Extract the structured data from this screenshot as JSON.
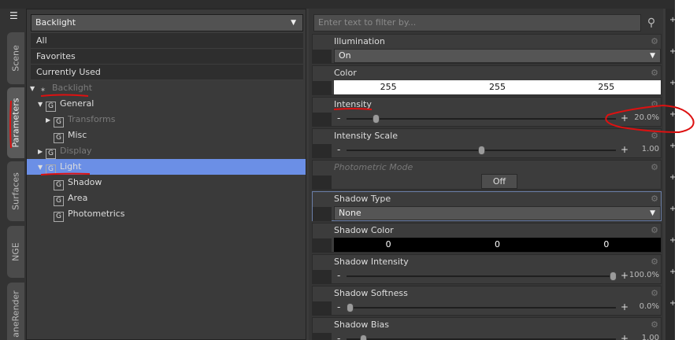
{
  "vertical_tabs": [
    "Scene",
    "Parameters",
    "Surfaces",
    "NGE",
    "aneRender"
  ],
  "active_tab": "Parameters",
  "left_panel": {
    "node_dropdown": "Backlight",
    "filters": [
      "All",
      "Favorites",
      "Currently Used"
    ],
    "tree": [
      {
        "label": "Backlight",
        "level": 0,
        "expanded": true,
        "dim": true,
        "icon": "light-icon"
      },
      {
        "label": "General",
        "level": 1,
        "expanded": true,
        "dim": false,
        "icon": "group-icon"
      },
      {
        "label": "Transforms",
        "level": 2,
        "expanded": false,
        "dim": true,
        "icon": "group-icon"
      },
      {
        "label": "Misc",
        "level": 2,
        "leaf": true,
        "dim": false,
        "icon": "group-icon"
      },
      {
        "label": "Display",
        "level": 1,
        "expanded": false,
        "dim": true,
        "icon": "group-icon"
      },
      {
        "label": "Light",
        "level": 1,
        "expanded": true,
        "dim": false,
        "selected": true,
        "icon": "group-icon"
      },
      {
        "label": "Shadow",
        "level": 2,
        "leaf": true,
        "dim": false,
        "icon": "group-icon"
      },
      {
        "label": "Area",
        "level": 2,
        "leaf": true,
        "dim": false,
        "icon": "group-icon"
      },
      {
        "label": "Photometrics",
        "level": 2,
        "leaf": true,
        "dim": false,
        "icon": "group-icon"
      }
    ]
  },
  "right_panel": {
    "search_placeholder": "Enter text to filter by...",
    "properties": [
      {
        "label": "Illumination",
        "type": "dropdown",
        "value": "On"
      },
      {
        "label": "Color",
        "type": "color",
        "values": [
          "255",
          "255",
          "255"
        ],
        "bg": "#ffffff",
        "fg": "#111111"
      },
      {
        "label": "Intensity",
        "type": "slider",
        "value": "20.0%",
        "fraction": 0.1
      },
      {
        "label": "Intensity Scale",
        "type": "slider",
        "value": "1.00",
        "fraction": 0.5
      },
      {
        "label": "Photometric Mode",
        "type": "button",
        "value": "Off",
        "disabled": true
      },
      {
        "label": "Shadow Type",
        "type": "dropdown",
        "value": "None",
        "highlight": true
      },
      {
        "label": "Shadow Color",
        "type": "color",
        "values": [
          "0",
          "0",
          "0"
        ],
        "bg": "#000000",
        "fg": "#ffffff"
      },
      {
        "label": "Shadow Intensity",
        "type": "slider",
        "value": "100.0%",
        "fraction": 1.0
      },
      {
        "label": "Shadow Softness",
        "type": "slider",
        "value": "0.0%",
        "fraction": 0.0
      },
      {
        "label": "Shadow Bias",
        "type": "slider",
        "value": "1.00",
        "fraction": 0.05
      }
    ]
  }
}
